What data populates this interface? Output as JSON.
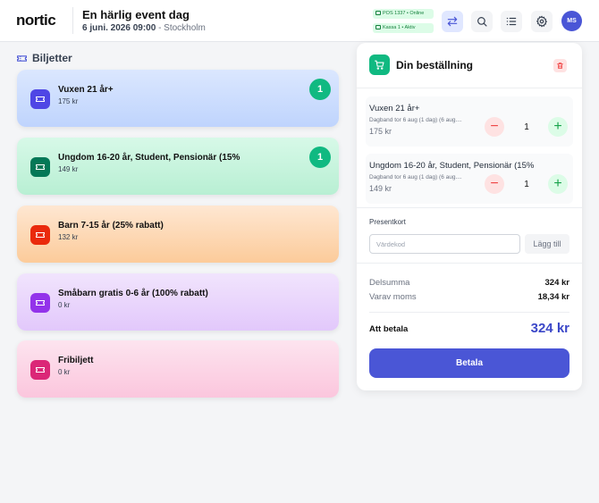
{
  "header": {
    "logo": "nortic",
    "event_title": "En härlig event dag",
    "event_date": "6 juni. 2026 09:00",
    "event_location": "- Stockholm",
    "pos_status": "POS 1337 • Online",
    "till_status": "Kassa 1 • Aktiv",
    "avatar_initials": "MS"
  },
  "tickets": {
    "section_title": "Biljetter",
    "items": [
      {
        "name": "Vuxen 21 år+",
        "price": "175 kr",
        "count": "1"
      },
      {
        "name": "Ungdom 16-20 år, Student, Pensionär (15%",
        "price": "149 kr",
        "count": "1"
      },
      {
        "name": "Barn 7-15 år (25% rabatt)",
        "price": "132 kr"
      },
      {
        "name": "Småbarn gratis 0-6 år (100% rabatt)",
        "price": "0 kr"
      },
      {
        "name": "Fribiljett",
        "price": "0 kr"
      }
    ]
  },
  "order": {
    "title": "Din beställning",
    "lines": [
      {
        "name": "Vuxen 21 år+",
        "desc": "Dagband tor 6 aug (1 dag) (6 aug....",
        "price": "175 kr",
        "qty": "1"
      },
      {
        "name": "Ungdom 16-20 år, Student, Pensionär (15%",
        "desc": "Dagband tor 6 aug (1 dag) (6 aug....",
        "price": "149 kr",
        "qty": "1"
      }
    ],
    "giftcard": {
      "label": "Presentkort",
      "placeholder": "Värdekod",
      "button": "Lägg till"
    },
    "subtotal_label": "Delsumma",
    "subtotal_value": "324 kr",
    "vat_label": "Varav moms",
    "vat_value": "18,34 kr",
    "total_label": "Att betala",
    "total_value": "324 kr",
    "pay_button": "Betala"
  },
  "colors": {
    "accent": "#4a56d6",
    "success": "#10b981",
    "danger": "#ef4444",
    "ticket_icons": [
      "#4f46e5",
      "#047857",
      "#ea2a0c",
      "#9333ea",
      "#db2777"
    ]
  },
  "icons": {
    "header": [
      "swap-icon",
      "search-icon",
      "list-icon",
      "settings-icon"
    ],
    "panel": [
      "cart-icon",
      "trash-icon"
    ],
    "ticket": "ticket-icon"
  }
}
